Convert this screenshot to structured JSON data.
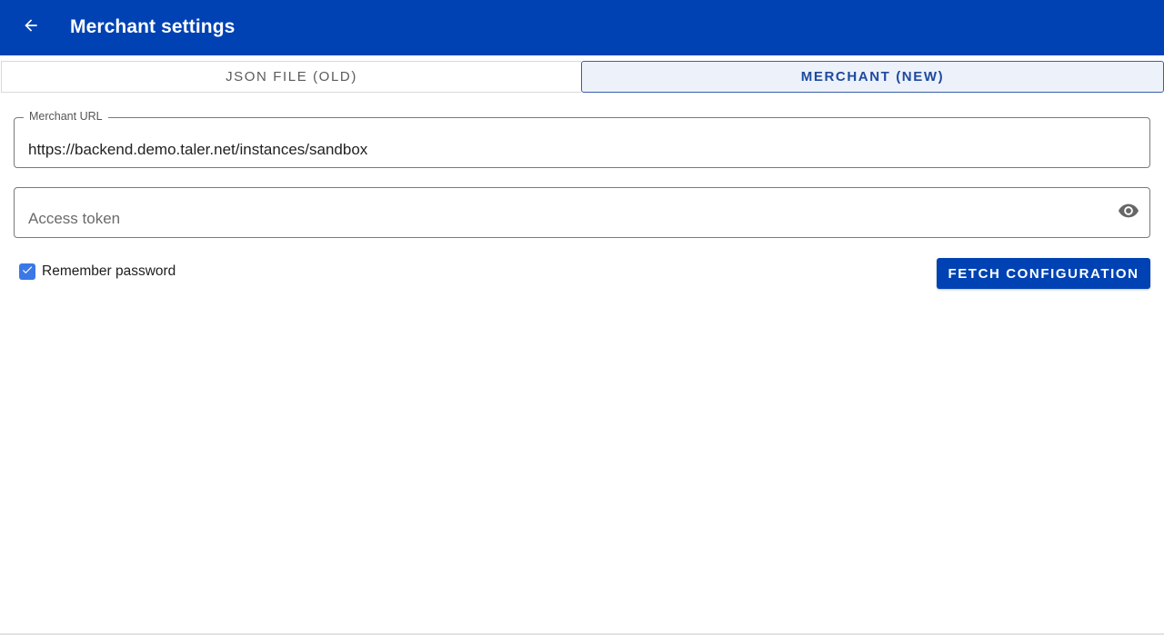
{
  "appbar": {
    "title": "Merchant settings",
    "back_icon": "arrow-left-icon",
    "color": "#0042b3"
  },
  "tabs": [
    {
      "label": "JSON FILE (OLD)",
      "selected": false
    },
    {
      "label": "MERCHANT (NEW)",
      "selected": true
    }
  ],
  "form": {
    "merchant_url": {
      "label": "Merchant URL",
      "value": "https://backend.demo.taler.net/instances/sandbox"
    },
    "access_token": {
      "placeholder": "Access token",
      "value": "",
      "icon": "eye-icon"
    },
    "remember_password": {
      "label": "Remember password",
      "checked": true
    },
    "fetch_button": {
      "label": "FETCH CONFIGURATION"
    }
  },
  "colors": {
    "primary": "#0042b3",
    "checkbox": "#3b78e7",
    "tab_selected_bg": "#ecf1fa"
  }
}
